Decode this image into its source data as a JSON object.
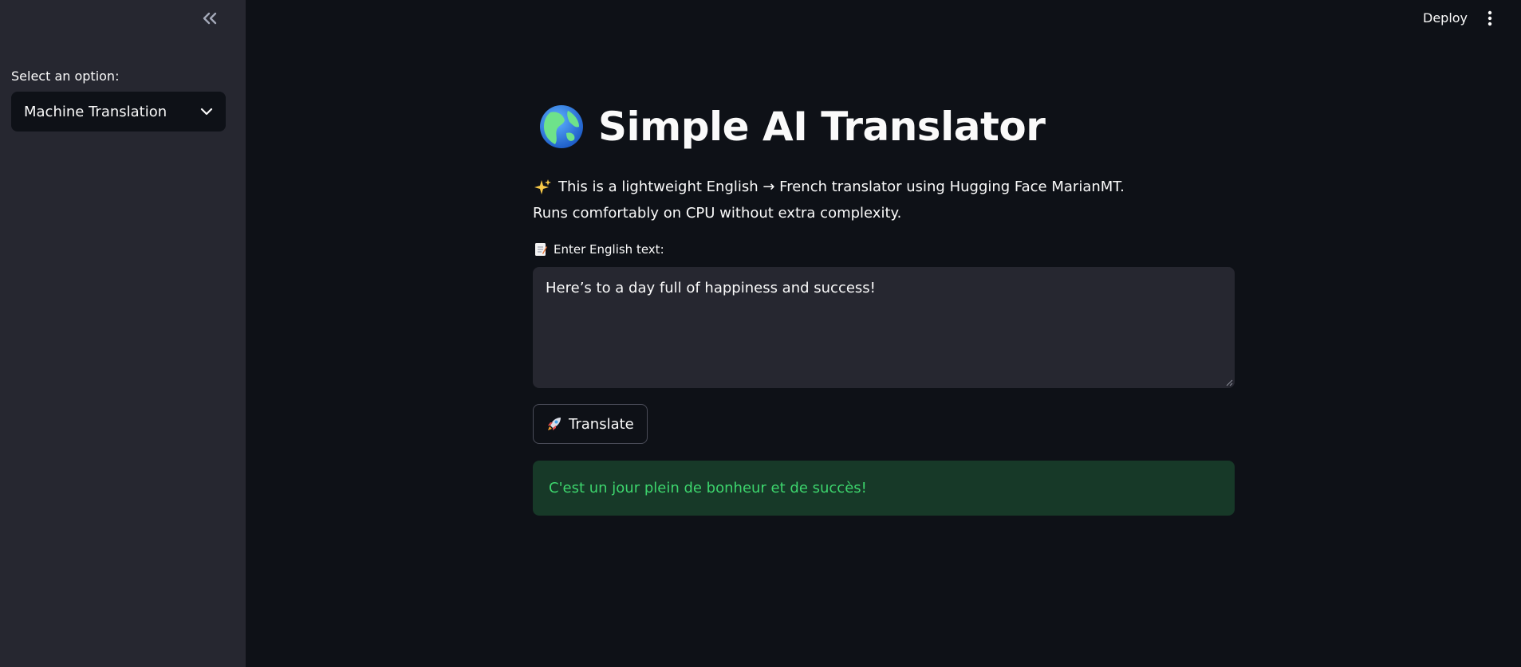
{
  "sidebar": {
    "collapse_icon": "double-chevron-left-icon",
    "select_label": "Select an option:",
    "select_value": "Machine Translation",
    "select_icon": "chevron-down-icon"
  },
  "header": {
    "deploy_label": "Deploy",
    "menu_icon": "vertical-dots-icon"
  },
  "main": {
    "title_icon": "globe-icon",
    "title": "Simple AI Translator",
    "description_icon": "sparkles-icon",
    "description_line1": "This is a lightweight English → French translator using Hugging Face MarianMT.",
    "description_line2": "Runs comfortably on CPU without extra complexity.",
    "input_icon": "memo-icon",
    "input_label": "Enter English text:",
    "input_value": "Here’s to a day full of happiness and success!",
    "button_icon": "rocket-icon",
    "button_label": "Translate",
    "result_text": "C'est un jour plein de bonheur et de succès!"
  },
  "colors": {
    "background": "#0e1117",
    "sidebar": "#262730",
    "success_bg": "#173928",
    "success_text": "#3dd56d"
  }
}
